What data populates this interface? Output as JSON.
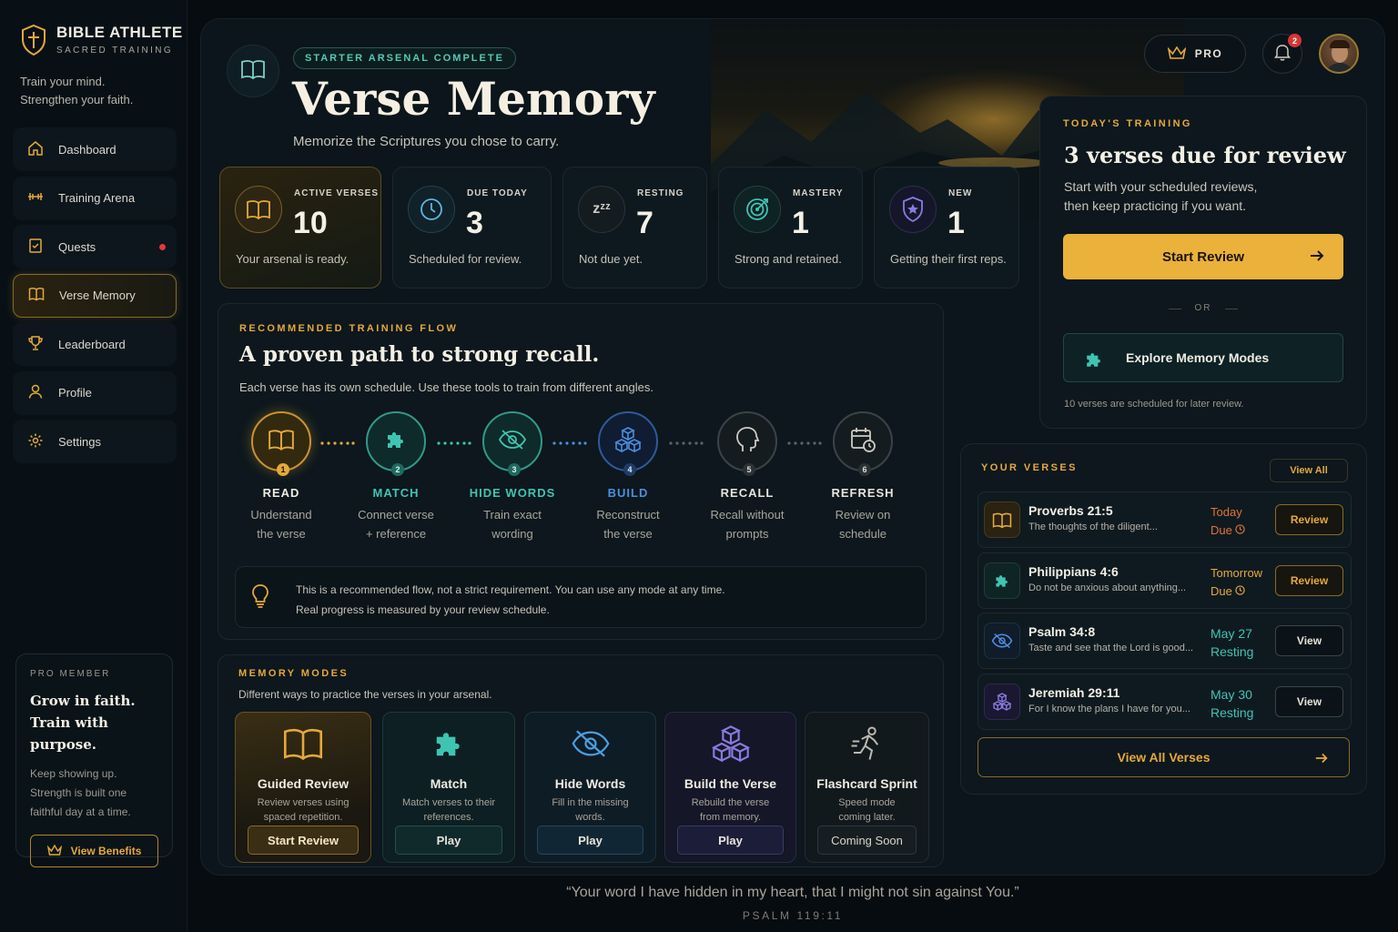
{
  "brand": {
    "name": "BIBLE ATHLETE",
    "sub": "SACRED TRAINING",
    "tagline1": "Train your mind.",
    "tagline2": "Strengthen your faith."
  },
  "nav": [
    {
      "label": "Dashboard",
      "icon": "home-icon"
    },
    {
      "label": "Training Arena",
      "icon": "dumbbell-icon"
    },
    {
      "label": "Quests",
      "icon": "scroll-icon",
      "dot": true
    },
    {
      "label": "Verse Memory",
      "icon": "book-icon",
      "active": true
    },
    {
      "label": "Leaderboard",
      "icon": "trophy-icon"
    },
    {
      "label": "Profile",
      "icon": "user-icon"
    },
    {
      "label": "Settings",
      "icon": "gear-icon"
    }
  ],
  "pro_card": {
    "label": "PRO MEMBER",
    "title1": "Grow in faith.",
    "title2": "Train with purpose.",
    "body1": "Keep showing up.",
    "body2": "Strength is built one",
    "body3": "faithful day at a time.",
    "button": "View Benefits"
  },
  "header": {
    "pill": "STARTER ARSENAL COMPLETE",
    "title": "Verse Memory",
    "subtitle": "Memorize the Scriptures you chose to carry.",
    "pro": "PRO",
    "notifications": "2"
  },
  "stats": [
    {
      "label": "ACTIVE VERSES",
      "value": "10",
      "desc": "Your arsenal is ready."
    },
    {
      "label": "DUE TODAY",
      "value": "3",
      "desc": "Scheduled for review."
    },
    {
      "label": "RESTING",
      "value": "7",
      "desc": "Not due yet."
    },
    {
      "label": "MASTERY",
      "value": "1",
      "desc": "Strong and retained."
    },
    {
      "label": "NEW",
      "value": "1",
      "desc": "Getting their first reps."
    }
  ],
  "flow": {
    "label": "RECOMMENDED TRAINING FLOW",
    "title": "A proven path to strong recall.",
    "desc": "Each verse has its own schedule. Use these tools to train from different angles.",
    "steps": [
      {
        "num": "1",
        "name": "READ",
        "d1": "Understand",
        "d2": "the verse"
      },
      {
        "num": "2",
        "name": "MATCH",
        "d1": "Connect verse",
        "d2": "+ reference"
      },
      {
        "num": "3",
        "name": "HIDE WORDS",
        "d1": "Train exact",
        "d2": "wording"
      },
      {
        "num": "4",
        "name": "BUILD",
        "d1": "Reconstruct",
        "d2": "the verse"
      },
      {
        "num": "5",
        "name": "RECALL",
        "d1": "Recall without",
        "d2": "prompts"
      },
      {
        "num": "6",
        "name": "REFRESH",
        "d1": "Review on",
        "d2": "schedule"
      }
    ],
    "note1": "This is a recommended flow, not a strict requirement. You can use any mode at any time.",
    "note2": "Real progress is measured by your review schedule."
  },
  "modes": {
    "label": "MEMORY MODES",
    "desc": "Different ways to practice the verses in your arsenal.",
    "items": [
      {
        "name": "Guided Review",
        "d1": "Review verses using",
        "d2": "spaced repetition.",
        "button": "Start Review"
      },
      {
        "name": "Match",
        "d1": "Match verses to their",
        "d2": "references.",
        "button": "Play"
      },
      {
        "name": "Hide Words",
        "d1": "Fill in the missing",
        "d2": "words.",
        "button": "Play"
      },
      {
        "name": "Build the Verse",
        "d1": "Rebuild the verse",
        "d2": "from memory.",
        "button": "Play"
      },
      {
        "name": "Flashcard Sprint",
        "d1": "Speed mode",
        "d2": "coming later.",
        "button": "Coming Soon"
      }
    ]
  },
  "today": {
    "label": "TODAY'S TRAINING",
    "title": "3 verses due for review",
    "desc1": "Start with your scheduled reviews,",
    "desc2": "then keep practicing if you want.",
    "start": "Start Review",
    "or": "OR",
    "explore": "Explore Memory Modes",
    "small": "10 verses are scheduled for later review."
  },
  "verses": {
    "label": "YOUR VERSES",
    "view_all": "View All",
    "items": [
      {
        "ref": "Proverbs 21:5",
        "excerpt": "The thoughts of the diligent...",
        "when": "Today",
        "status": "Due",
        "action": "Review"
      },
      {
        "ref": "Philippians 4:6",
        "excerpt": "Do not be anxious about anything...",
        "when": "Tomorrow",
        "status": "Due",
        "action": "Review"
      },
      {
        "ref": "Psalm 34:8",
        "excerpt": "Taste and see that the Lord is good...",
        "when": "May 27",
        "status": "Resting",
        "action": "View"
      },
      {
        "ref": "Jeremiah 29:11",
        "excerpt": "For I know the plans I have for you...",
        "when": "May 30",
        "status": "Resting",
        "action": "View"
      }
    ],
    "all_button": "View All Verses"
  },
  "footer": {
    "quote": "“Your word I have hidden in my heart, that I might not sin against You.”",
    "ref": "PSALM 119:11"
  },
  "colors": {
    "gold": "#e5a93a",
    "teal": "#3fc4b2",
    "blue": "#4a8fe0",
    "purple": "#8a7ae0",
    "red": "#e03a3a"
  }
}
